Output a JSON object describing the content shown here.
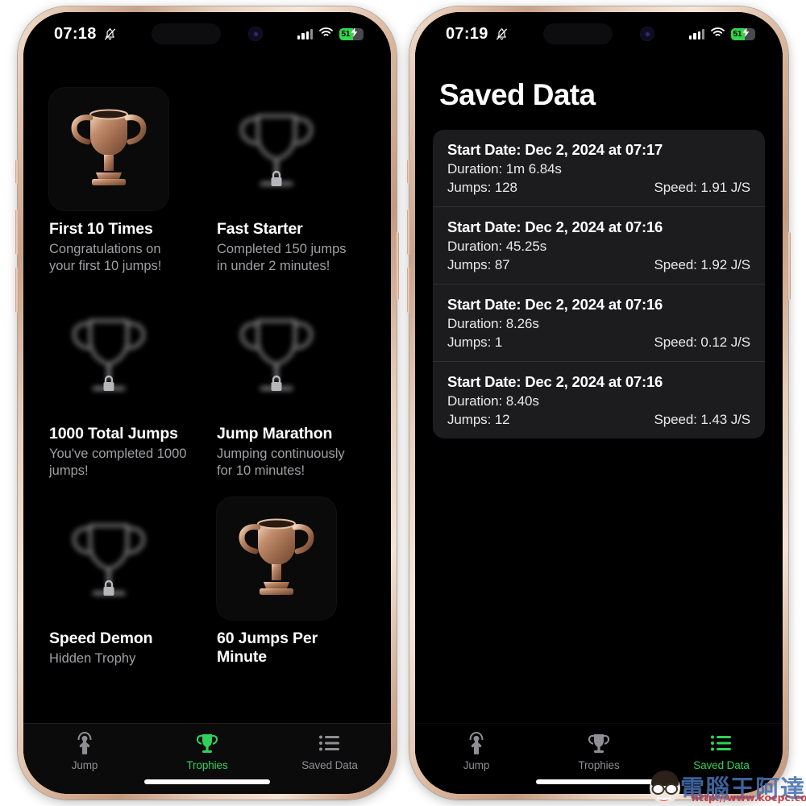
{
  "app": {
    "accent_color": "#30d158",
    "screen_background": "#000000",
    "card_background": "#1c1c1e"
  },
  "phones": {
    "left": {
      "status_bar": {
        "time": "07:18",
        "silent_icon": "bell-slash-icon",
        "face_id_icon": "face-id-icon",
        "cellular_icon": "cellular-bars-icon",
        "wifi_icon": "wifi-icon",
        "battery_percent": "51",
        "battery_charging": true
      },
      "screen_name": "Trophies",
      "trophies": [
        {
          "title": "First 10 Times",
          "description": "Congratulations on your first 10 jumps!",
          "locked": false
        },
        {
          "title": "Fast Starter",
          "description": "Completed 150 jumps in under 2 minutes!",
          "locked": true
        },
        {
          "title": "1000 Total Jumps",
          "description": "You've completed 1000 jumps!",
          "locked": true
        },
        {
          "title": "Jump Marathon",
          "description": "Jumping continuously for 10 minutes!",
          "locked": true
        },
        {
          "title": "Speed Demon",
          "description": "Hidden Trophy",
          "locked": true
        },
        {
          "title": "60 Jumps Per Minute",
          "description": "",
          "locked": false
        }
      ],
      "tabs": [
        {
          "label": "Jump",
          "icon": "jump-rope-icon",
          "active": false
        },
        {
          "label": "Trophies",
          "icon": "trophy-icon",
          "active": true
        },
        {
          "label": "Saved Data",
          "icon": "list-icon",
          "active": false
        }
      ]
    },
    "right": {
      "status_bar": {
        "time": "07:19",
        "silent_icon": "bell-slash-icon",
        "face_id_icon": "face-id-icon",
        "cellular_icon": "cellular-bars-icon",
        "wifi_icon": "wifi-icon",
        "battery_percent": "51",
        "battery_charging": true
      },
      "screen_name": "Saved Data",
      "page_title": "Saved Data",
      "records": [
        {
          "date": "Start Date: Dec 2, 2024 at 07:17",
          "duration": "Duration: 1m 6.84s",
          "jumps": "Jumps: 128",
          "speed": "Speed: 1.91 J/S"
        },
        {
          "date": "Start Date: Dec 2, 2024 at 07:16",
          "duration": "Duration: 45.25s",
          "jumps": "Jumps: 87",
          "speed": "Speed: 1.92 J/S"
        },
        {
          "date": "Start Date: Dec 2, 2024 at 07:16",
          "duration": "Duration: 8.26s",
          "jumps": "Jumps: 1",
          "speed": "Speed: 0.12 J/S"
        },
        {
          "date": "Start Date: Dec 2, 2024 at 07:16",
          "duration": "Duration: 8.40s",
          "jumps": "Jumps: 12",
          "speed": "Speed: 1.43 J/S"
        }
      ],
      "tabs": [
        {
          "label": "Jump",
          "icon": "jump-rope-icon",
          "active": false
        },
        {
          "label": "Trophies",
          "icon": "trophy-icon",
          "active": false
        },
        {
          "label": "Saved Data",
          "icon": "list-icon",
          "active": true
        }
      ]
    }
  },
  "watermark": {
    "text": "電腦王阿達",
    "url": "http://www.kocpc.com.tw"
  }
}
